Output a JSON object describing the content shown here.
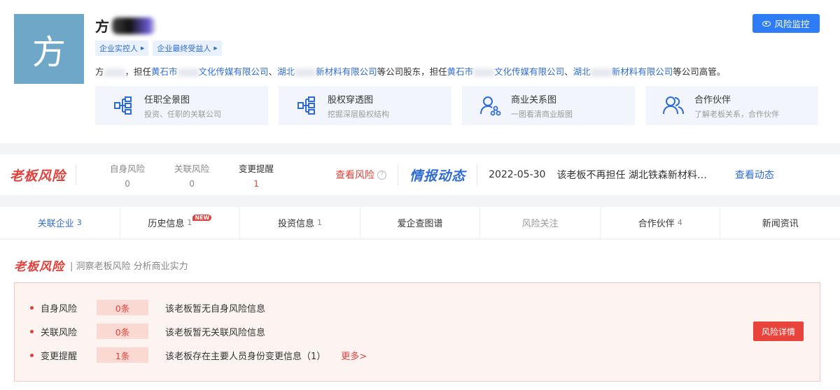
{
  "header": {
    "avatar_char": "方",
    "name": "方",
    "tags": [
      "企业实控人",
      "企业最终受益人"
    ],
    "desc": {
      "p1": "方",
      "p2": "，担任",
      "l1": "黄石市",
      "l2": "文化传媒有限公司",
      "p3": "、",
      "l3": "湖北",
      "l4": "新材料有限公司",
      "p4": "等公司股东，担任",
      "l5": "黄石市",
      "l6": "文化传媒有限公司",
      "p5": "、",
      "l7": "湖北",
      "l8": "新材料有限公司",
      "p6": "等公司高管。"
    },
    "monitor_label": "风险监控",
    "cards": [
      {
        "title": "任职全景图",
        "sub": "投资、任职的关联公司",
        "icon": "org-chart-icon"
      },
      {
        "title": "股权穿透图",
        "sub": "挖掘深层股权结构",
        "icon": "equity-tree-icon"
      },
      {
        "title": "商业关系图",
        "sub": "一图看清商业版图",
        "icon": "business-network-icon"
      },
      {
        "title": "合作伙伴",
        "sub": "了解老板关系，合作伙伴",
        "icon": "partners-icon"
      }
    ]
  },
  "risk_strip": {
    "brand": "老板风险",
    "stats": [
      {
        "label": "自身风险",
        "value": "0"
      },
      {
        "label": "关联风险",
        "value": "0"
      },
      {
        "label": "变更提醒",
        "value": "1"
      }
    ],
    "view_risk": "查看风险",
    "news_brand": "情报动态",
    "news_date": "2022-05-30",
    "news_text": "该老板不再担任 湖北铁森新材料…",
    "view_news": "查看动态"
  },
  "tabs": [
    {
      "label": "关联企业",
      "count": "3"
    },
    {
      "label": "历史信息",
      "count": "1",
      "badge": "NEW"
    },
    {
      "label": "投资信息",
      "count": "1"
    },
    {
      "label": "爱企查图谱",
      "count": ""
    },
    {
      "label": "风险关注",
      "count": ""
    },
    {
      "label": "合作伙伴",
      "count": "4"
    },
    {
      "label": "新闻资讯",
      "count": ""
    }
  ],
  "section": {
    "title": "老板风险",
    "subtitle": "| 洞察老板风险 分析商业实力",
    "rows": [
      {
        "label": "自身风险",
        "count": "0条",
        "text": "该老板暂无自身风险信息"
      },
      {
        "label": "关联风险",
        "count": "0条",
        "text": "该老板暂无关联风险信息"
      },
      {
        "label": "变更提醒",
        "count": "1条",
        "text": "该老板存在主要人员身份变更信息（1）",
        "more": "更多>"
      }
    ],
    "detail_button": "风险详情"
  },
  "colors": {
    "accent_blue": "#2e7cf6",
    "risk_red": "#e0413a",
    "avatar_bg": "#6ea7c8"
  }
}
